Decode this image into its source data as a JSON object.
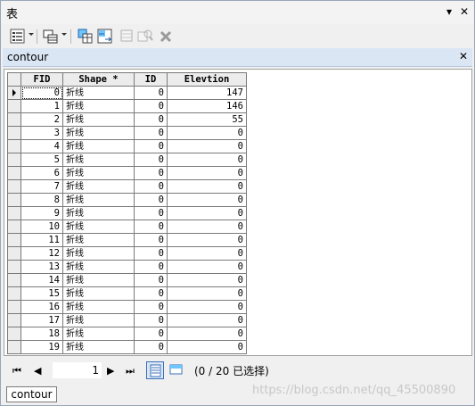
{
  "window": {
    "title": "表",
    "pin": "▾",
    "close": "✕"
  },
  "tab": {
    "title": "contour",
    "close": "✕"
  },
  "table": {
    "columns": [
      "FID",
      "Shape *",
      "ID",
      "Elevtion"
    ],
    "rows": [
      {
        "fid": "0",
        "shape": "折线",
        "id": "0",
        "elev": "147"
      },
      {
        "fid": "1",
        "shape": "折线",
        "id": "0",
        "elev": "146"
      },
      {
        "fid": "2",
        "shape": "折线",
        "id": "0",
        "elev": "55"
      },
      {
        "fid": "3",
        "shape": "折线",
        "id": "0",
        "elev": "0"
      },
      {
        "fid": "4",
        "shape": "折线",
        "id": "0",
        "elev": "0"
      },
      {
        "fid": "5",
        "shape": "折线",
        "id": "0",
        "elev": "0"
      },
      {
        "fid": "6",
        "shape": "折线",
        "id": "0",
        "elev": "0"
      },
      {
        "fid": "7",
        "shape": "折线",
        "id": "0",
        "elev": "0"
      },
      {
        "fid": "8",
        "shape": "折线",
        "id": "0",
        "elev": "0"
      },
      {
        "fid": "9",
        "shape": "折线",
        "id": "0",
        "elev": "0"
      },
      {
        "fid": "10",
        "shape": "折线",
        "id": "0",
        "elev": "0"
      },
      {
        "fid": "11",
        "shape": "折线",
        "id": "0",
        "elev": "0"
      },
      {
        "fid": "12",
        "shape": "折线",
        "id": "0",
        "elev": "0"
      },
      {
        "fid": "13",
        "shape": "折线",
        "id": "0",
        "elev": "0"
      },
      {
        "fid": "14",
        "shape": "折线",
        "id": "0",
        "elev": "0"
      },
      {
        "fid": "15",
        "shape": "折线",
        "id": "0",
        "elev": "0"
      },
      {
        "fid": "16",
        "shape": "折线",
        "id": "0",
        "elev": "0"
      },
      {
        "fid": "17",
        "shape": "折线",
        "id": "0",
        "elev": "0"
      },
      {
        "fid": "18",
        "shape": "折线",
        "id": "0",
        "elev": "0"
      },
      {
        "fid": "19",
        "shape": "折线",
        "id": "0",
        "elev": "0"
      }
    ]
  },
  "nav": {
    "first": "⏮",
    "prev": "◀",
    "current_record": "1",
    "next": "▶",
    "last": "⏭",
    "status": "(0 / 20 已选择)"
  },
  "bottom_tab": {
    "label": "contour"
  },
  "watermark": "https://blog.csdn.net/qq_45500890",
  "colors": {
    "tab_bar": "#dbe6f4",
    "window_bg": "#f0f0f0",
    "view_active": "#3a6fb7"
  }
}
